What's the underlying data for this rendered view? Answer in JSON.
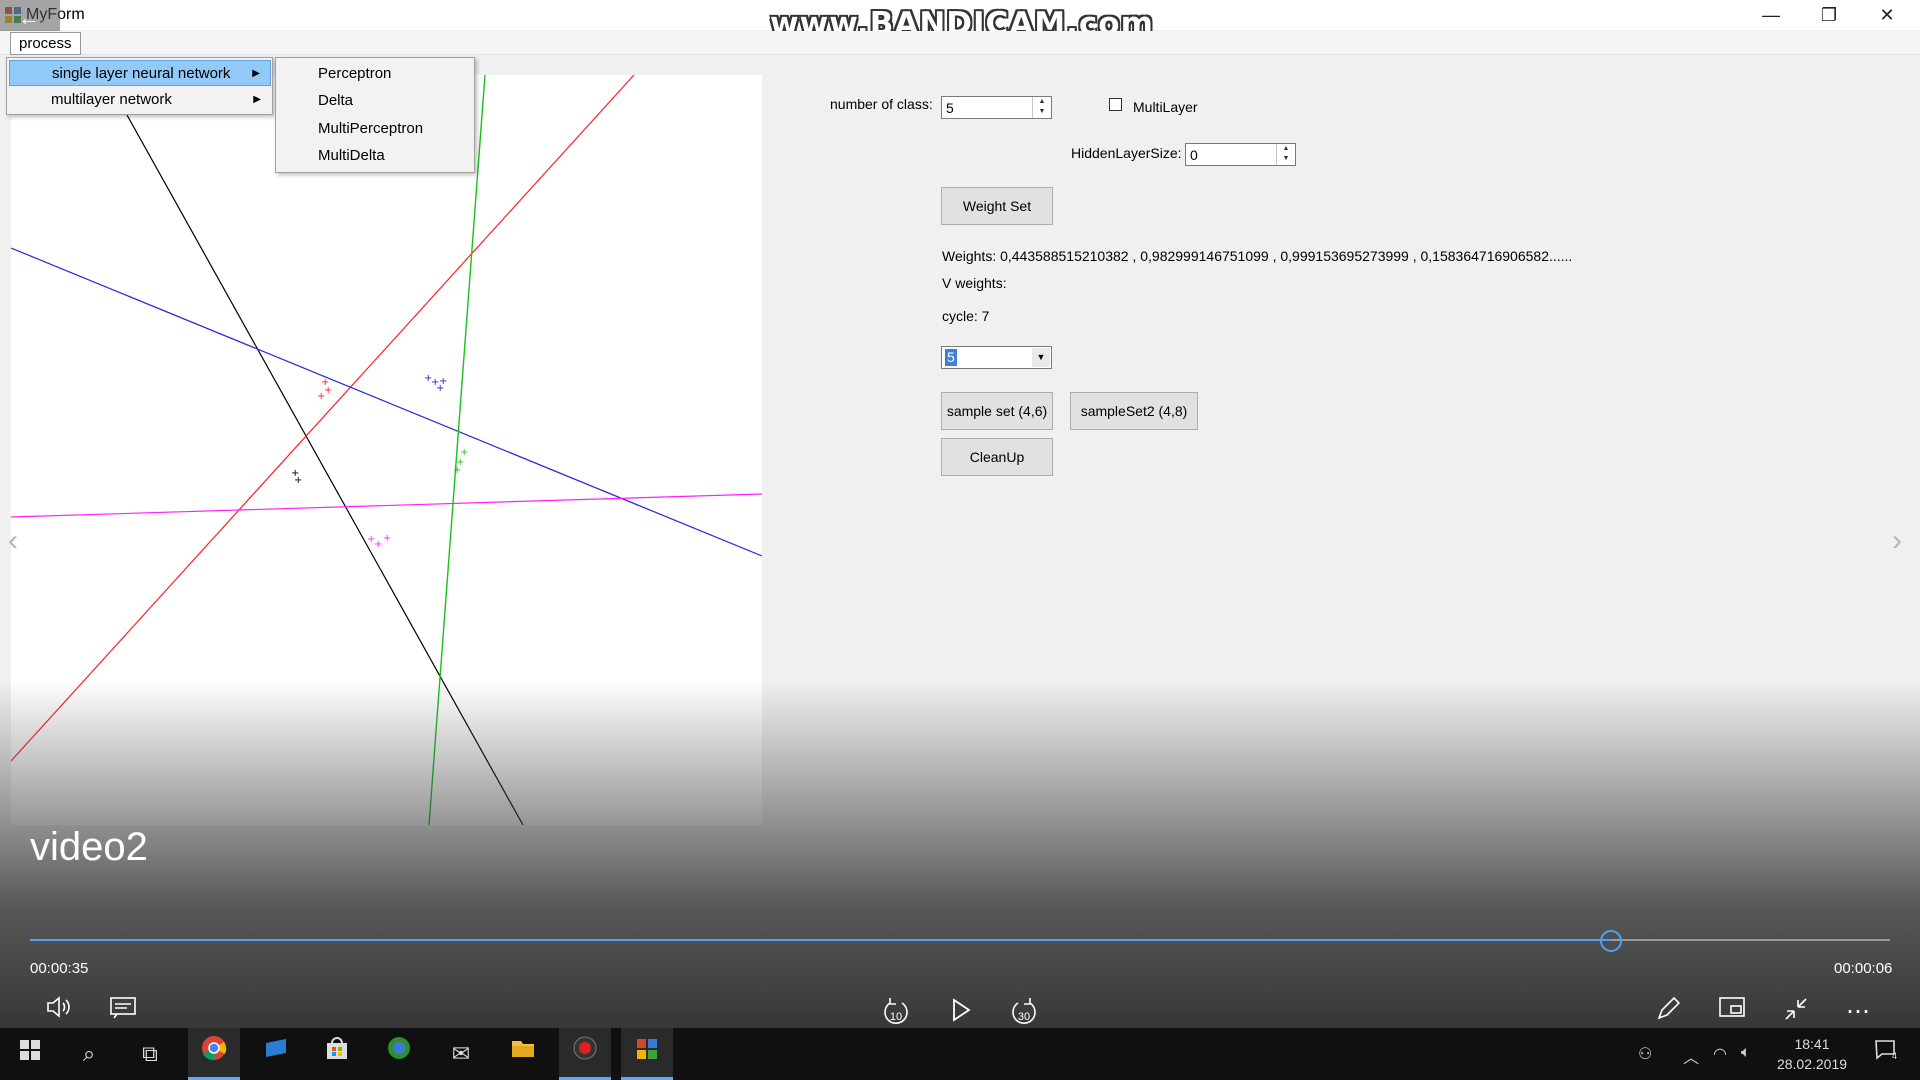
{
  "window": {
    "title": "MyForm",
    "watermark": "www.BANDICAM.com"
  },
  "menu": {
    "process_label": "process",
    "items": [
      {
        "label": "single layer neural network"
      },
      {
        "label": "multilayer network"
      }
    ],
    "submenu": [
      {
        "label": "Perceptron"
      },
      {
        "label": "Delta"
      },
      {
        "label": "MultiPerceptron"
      },
      {
        "label": "MultiDelta"
      }
    ]
  },
  "form": {
    "class_count_label": "number of class:",
    "class_count_value": "5",
    "multilayer_label": "MultiLayer",
    "multilayer_checked": false,
    "hidden_label": "HiddenLayerSize:",
    "hidden_value": "0",
    "weight_set_button": "Weight Set",
    "weights_text": "Weights: 0,443588515210382 , 0,982999146751099 , 0,999153695273999 , 0,158364716906582......",
    "v_weights_text": "V weights:",
    "cycle_text": "cycle: 7",
    "combo_value": "5",
    "sample_set_button": "sample set (4,6)",
    "sample_set2_button": "sampleSet2 (4,8)",
    "cleanup_button": "CleanUp"
  },
  "plot": {
    "colors": {
      "black": "#000000",
      "red": "#ff2020",
      "blue": "#2323e0",
      "green": "#19c219",
      "magenta": "#ff20ff"
    }
  },
  "video": {
    "title": "video2",
    "elapsed": "00:00:35",
    "remaining": "00:00:06",
    "progress": 0.85,
    "skip_back": "10",
    "skip_forward": "30"
  },
  "taskbar": {
    "time": "18:41",
    "date": "28.02.2019",
    "notification_count": "4"
  }
}
